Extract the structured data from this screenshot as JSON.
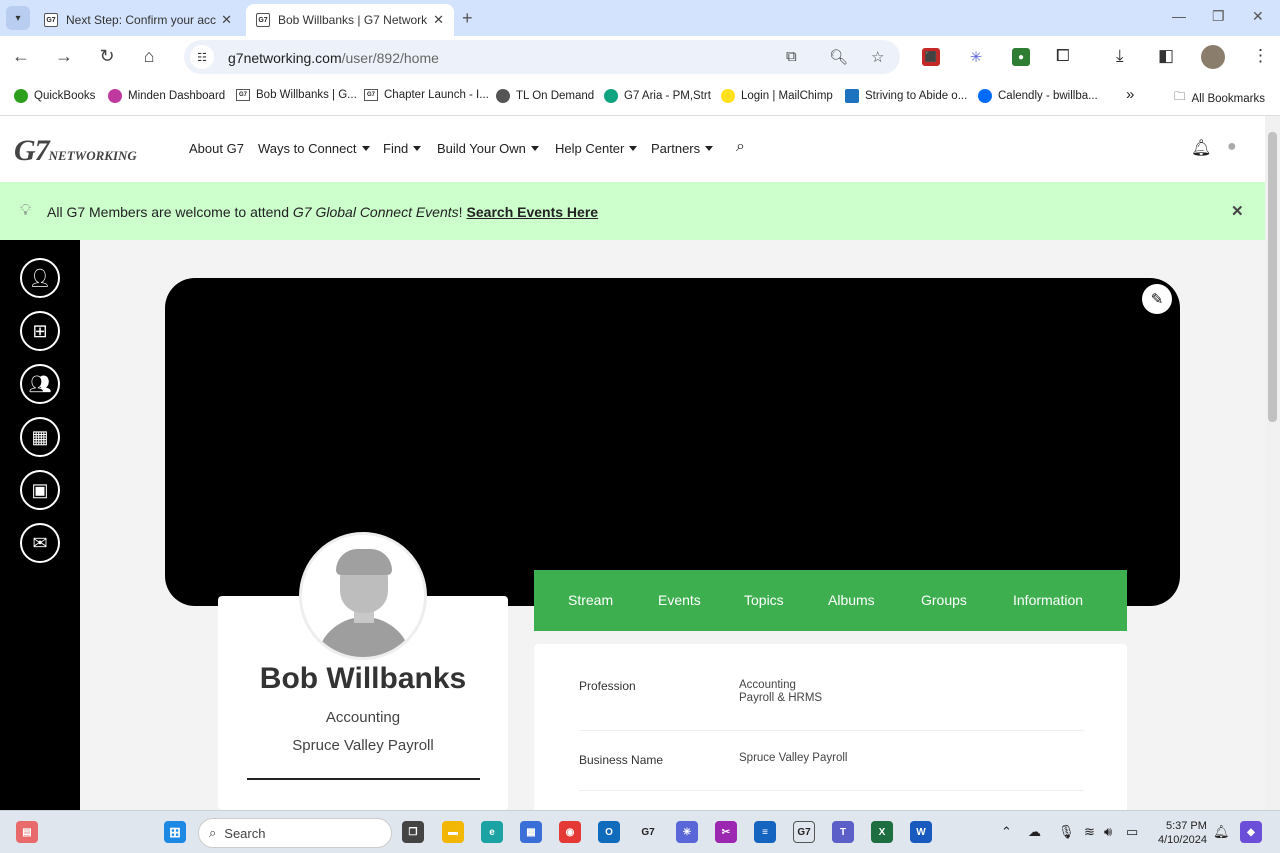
{
  "browser": {
    "tabs": [
      {
        "label": "Next Step: Confirm your acc",
        "favicon": "G7",
        "active": false
      },
      {
        "label": "Bob Willbanks | G7 Network",
        "favicon": "G7",
        "active": true
      }
    ],
    "url_domain": "g7networking.com",
    "url_path": "/user/892/home",
    "bookmarks": [
      {
        "label": "QuickBooks",
        "color": "#2ca01c"
      },
      {
        "label": "Minden Dashboard",
        "color": "#c0399f"
      },
      {
        "label": "Bob Willbanks | G...",
        "color": ""
      },
      {
        "label": "Chapter Launch - I...",
        "color": ""
      },
      {
        "label": "TL On Demand",
        "color": "#555555"
      },
      {
        "label": "G7 Aria - PM,Strt",
        "color": "#10a37f"
      },
      {
        "label": "Login | MailChimp",
        "color": "#ffe01b"
      },
      {
        "label": "Striving to Abide o...",
        "color": "#1e73be"
      },
      {
        "label": "Calendly - bwillba...",
        "color": "#006bff"
      }
    ],
    "all_bookmarks": "All Bookmarks",
    "more_bookmarks": "»"
  },
  "site": {
    "logo_main": "G7",
    "logo_sub": "NETWORKING",
    "nav": [
      {
        "label": "About G7",
        "dropdown": false
      },
      {
        "label": "Ways to Connect",
        "dropdown": true
      },
      {
        "label": "Find",
        "dropdown": true
      },
      {
        "label": "Build Your Own",
        "dropdown": true
      },
      {
        "label": "Help Center",
        "dropdown": true
      },
      {
        "label": "Partners",
        "dropdown": true
      }
    ]
  },
  "banner": {
    "prefix": "All G7 Members are welcome to attend ",
    "emphasis": "G7 Global Connect Events",
    "suffix": "!",
    "link": "Search Events Here",
    "close": "✕"
  },
  "profile": {
    "name": "Bob Willbanks",
    "profession": "Accounting",
    "company": "Spruce Valley Payroll",
    "tabs": [
      "Stream",
      "Events",
      "Topics",
      "Albums",
      "Groups",
      "Information"
    ],
    "info": [
      {
        "label": "Profession",
        "value_line1": "Accounting",
        "value_line2": "Payroll & HRMS"
      },
      {
        "label": "Business Name",
        "value_line1": "Spruce Valley Payroll",
        "value_line2": ""
      }
    ]
  },
  "taskbar": {
    "search_placeholder": "Search",
    "time": "5:37 PM",
    "date": "4/10/2024",
    "g7_label": "G7"
  }
}
